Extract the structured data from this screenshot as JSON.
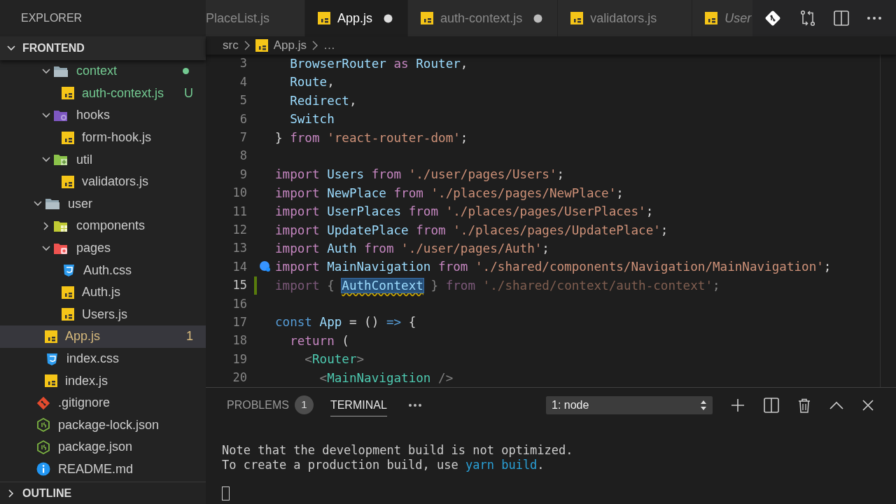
{
  "sidebar": {
    "title": "EXPLORER",
    "section": "FRONTEND",
    "tree": [
      {
        "children": [
          {
            "children": [
              {
                "label": "context",
                "kind": "folder",
                "expanded": true,
                "selected": false,
                "color": "#73c991",
                "dot": true,
                "children": [
                  {
                    "label": "auth-context.js",
                    "kind": "js",
                    "selected": false,
                    "color": "#73c991",
                    "badge": "U"
                  }
                ]
              },
              {
                "label": "hooks",
                "kind": "hooks",
                "expanded": true,
                "selected": false,
                "children": [
                  {
                    "label": "form-hook.js",
                    "kind": "js",
                    "selected": false
                  }
                ]
              },
              {
                "label": "util",
                "kind": "util",
                "expanded": true,
                "selected": false,
                "children": [
                  {
                    "label": "validators.js",
                    "kind": "js",
                    "selected": false
                  }
                ]
              }
            ]
          },
          {
            "label": "user",
            "kind": "folder",
            "expanded": true,
            "selected": false,
            "children": [
              {
                "label": "components",
                "kind": "components",
                "expanded": false,
                "selected": false
              },
              {
                "label": "pages",
                "kind": "pages",
                "expanded": true,
                "selected": false,
                "children": [
                  {
                    "label": "Auth.css",
                    "kind": "css",
                    "selected": false
                  },
                  {
                    "label": "Auth.js",
                    "kind": "js",
                    "selected": false
                  },
                  {
                    "label": "Users.js",
                    "kind": "js",
                    "selected": false
                  }
                ]
              }
            ]
          },
          {
            "label": "App.js",
            "kind": "js",
            "selected": true,
            "color": "#d7ba7d",
            "badge": "1"
          },
          {
            "label": "index.css",
            "kind": "css",
            "selected": false
          },
          {
            "label": "index.js",
            "kind": "js",
            "selected": false
          }
        ]
      },
      {
        "label": ".gitignore",
        "kind": "git",
        "selected": false
      },
      {
        "label": "package-lock.json",
        "kind": "node",
        "selected": false
      },
      {
        "label": "package.json",
        "kind": "node",
        "selected": false
      },
      {
        "label": "README.md",
        "kind": "info",
        "selected": false
      }
    ],
    "outline": {
      "label": "OUTLINE",
      "expanded": false
    }
  },
  "tabs": [
    {
      "label": "PlaceList.js",
      "selected": false,
      "dirty": false
    },
    {
      "label": "App.js",
      "kind": "js",
      "selected": true,
      "dirty": true
    },
    {
      "label": "auth-context.js",
      "kind": "js",
      "selected": false,
      "dirty": true
    },
    {
      "label": "validators.js",
      "kind": "js",
      "selected": false,
      "dirty": false
    },
    {
      "label": "User",
      "kind": "js",
      "selected": false,
      "preview": true
    }
  ],
  "editor_actions": [
    {
      "kind": "git"
    },
    {
      "kind": "compare"
    },
    {
      "kind": "split"
    },
    {
      "kind": "more"
    }
  ],
  "breadcrumbs": [
    {
      "text": "src"
    },
    {
      "text": "App.js",
      "kind": "js"
    },
    {
      "text": "…"
    }
  ],
  "code": [
    {
      "number": "3",
      "tokens": [
        {
          "kind": "variable",
          "text": "  BrowserRouter "
        },
        {
          "kind": "keyword",
          "text": "as"
        },
        {
          "kind": "variable",
          "text": " Router"
        },
        {
          "kind": "text",
          "text": ","
        }
      ]
    },
    {
      "number": "4",
      "tokens": [
        {
          "kind": "variable",
          "text": "  Route"
        },
        {
          "kind": "text",
          "text": ","
        }
      ]
    },
    {
      "number": "5",
      "tokens": [
        {
          "kind": "variable",
          "text": "  Redirect"
        },
        {
          "kind": "text",
          "text": ","
        }
      ]
    },
    {
      "number": "6",
      "tokens": [
        {
          "kind": "variable",
          "text": "  Switch"
        }
      ]
    },
    {
      "number": "7",
      "tokens": [
        {
          "kind": "text",
          "text": "} "
        },
        {
          "kind": "keyword",
          "text": "from"
        },
        {
          "kind": "string",
          "text": " 'react-router-dom'"
        },
        {
          "kind": "text",
          "text": ";"
        }
      ]
    },
    {
      "number": "8"
    },
    {
      "number": "9",
      "tokens": [
        {
          "kind": "keyword",
          "text": "import"
        },
        {
          "kind": "variable",
          "text": " Users "
        },
        {
          "kind": "keyword",
          "text": "from"
        },
        {
          "kind": "string",
          "text": " './user/pages/Users'"
        },
        {
          "kind": "text",
          "text": ";"
        }
      ]
    },
    {
      "number": "10",
      "tokens": [
        {
          "kind": "keyword",
          "text": "import"
        },
        {
          "kind": "variable",
          "text": " NewPlace "
        },
        {
          "kind": "keyword",
          "text": "from"
        },
        {
          "kind": "string",
          "text": " './places/pages/NewPlace'"
        },
        {
          "kind": "text",
          "text": ";"
        }
      ]
    },
    {
      "number": "11",
      "tokens": [
        {
          "kind": "keyword",
          "text": "import"
        },
        {
          "kind": "variable",
          "text": " UserPlaces "
        },
        {
          "kind": "keyword",
          "text": "from"
        },
        {
          "kind": "string",
          "text": " './places/pages/UserPlaces'"
        },
        {
          "kind": "text",
          "text": ";"
        }
      ]
    },
    {
      "number": "12",
      "tokens": [
        {
          "kind": "keyword",
          "text": "import"
        },
        {
          "kind": "variable",
          "text": " UpdatePlace "
        },
        {
          "kind": "keyword",
          "text": "from"
        },
        {
          "kind": "string",
          "text": " './places/pages/UpdatePlace'"
        },
        {
          "kind": "text",
          "text": ";"
        }
      ]
    },
    {
      "number": "13",
      "tokens": [
        {
          "kind": "keyword",
          "text": "import"
        },
        {
          "kind": "variable",
          "text": " Auth "
        },
        {
          "kind": "keyword",
          "text": "from"
        },
        {
          "kind": "string",
          "text": " './user/pages/Auth'"
        },
        {
          "kind": "text",
          "text": ";"
        }
      ]
    },
    {
      "number": "14",
      "hint": true,
      "tokens": [
        {
          "kind": "keyword",
          "text": "import"
        },
        {
          "kind": "variable",
          "text": " MainNavigation "
        },
        {
          "kind": "keyword",
          "text": "from"
        },
        {
          "kind": "string",
          "text": " './shared/components/Navigation/MainNavigation'"
        },
        {
          "kind": "text",
          "text": ";"
        }
      ]
    },
    {
      "number": "15",
      "current": true,
      "added": true,
      "faded": true,
      "tokens": [
        {
          "kind": "keyword",
          "text": "import"
        },
        {
          "kind": "text",
          "text": " { "
        },
        {
          "kind": "variable",
          "text": "AuthContext",
          "highlight": true
        },
        {
          "kind": "text",
          "text": " } "
        },
        {
          "kind": "keyword",
          "text": "from"
        },
        {
          "kind": "string",
          "text": " './shared/context/auth-context'"
        },
        {
          "kind": "text",
          "text": ";"
        }
      ]
    },
    {
      "number": "16"
    },
    {
      "number": "17",
      "tokens": [
        {
          "kind": "storage",
          "text": "const"
        },
        {
          "kind": "variable",
          "text": " App"
        },
        {
          "kind": "text",
          "text": " = () "
        },
        {
          "kind": "storage",
          "text": "=>"
        },
        {
          "kind": "text",
          "text": " {"
        }
      ]
    },
    {
      "number": "18",
      "tokens": [
        {
          "kind": "keyword",
          "text": "  return"
        },
        {
          "kind": "text",
          "text": " ("
        }
      ]
    },
    {
      "number": "19",
      "tokens": [
        {
          "kind": "bracket",
          "text": "    <"
        },
        {
          "kind": "tag",
          "text": "Router"
        },
        {
          "kind": "bracket",
          "text": ">"
        }
      ]
    },
    {
      "number": "20",
      "tokens": [
        {
          "kind": "bracket",
          "text": "      <"
        },
        {
          "kind": "tag",
          "text": "MainNavigation"
        },
        {
          "kind": "bracket",
          "text": " />"
        }
      ]
    }
  ],
  "panel": {
    "tabs": [
      {
        "label": "PROBLEMS",
        "count": "1",
        "selected": false
      },
      {
        "label": "TERMINAL",
        "selected": true
      }
    ],
    "terminal_select": "1: node",
    "actions": [
      {
        "kind": "add"
      },
      {
        "kind": "split"
      },
      {
        "kind": "trash"
      },
      {
        "kind": "maximize"
      },
      {
        "kind": "close"
      }
    ],
    "terminal": {
      "lines": [
        [
          {
            "kind": "plain",
            "text": "Note that the development build is not optimized."
          }
        ],
        [
          {
            "kind": "plain",
            "text": "To create a production build, use "
          },
          {
            "kind": "command",
            "text": "yarn build"
          },
          {
            "kind": "plain",
            "text": "."
          }
        ]
      ],
      "cursor": true
    }
  }
}
